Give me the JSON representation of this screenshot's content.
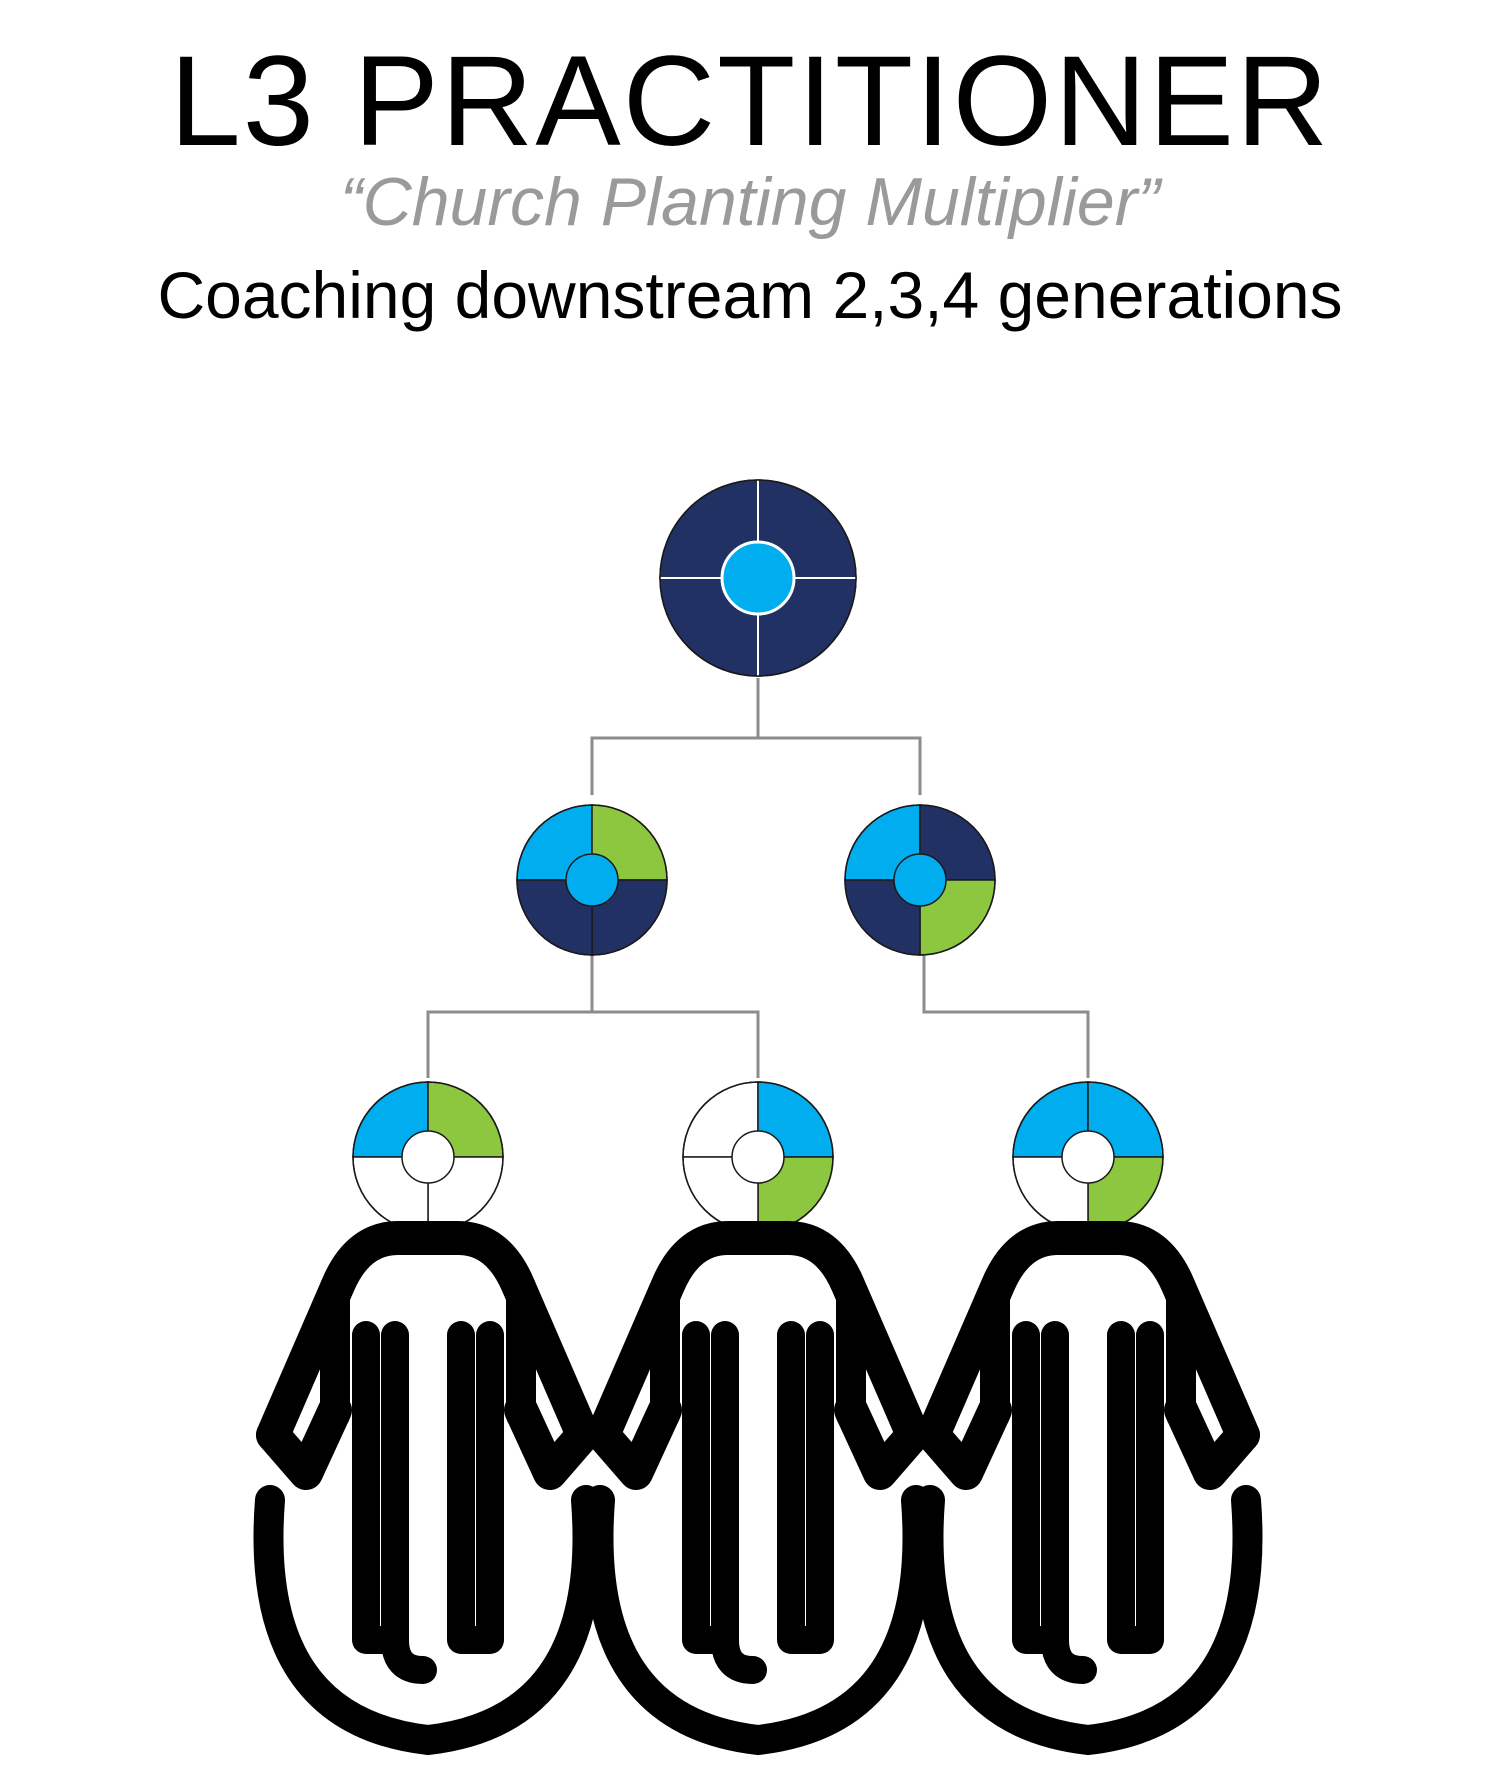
{
  "header": {
    "title": "L3 PRACTITIONER",
    "subtitle": "“Church Planting Multiplier”",
    "tagline": "Coaching downstream 2,3,4 generations"
  },
  "colors": {
    "navy": "#223163",
    "light_blue": "#00aeef",
    "green": "#8dc63f",
    "empty": "#ffffff",
    "connector": "#8c8c8c",
    "figure": "#000000"
  },
  "tree": {
    "generation_1": [
      {
        "quadrants": {
          "top_left": "navy",
          "top_right": "navy",
          "bottom_left": "navy",
          "bottom_right": "navy"
        },
        "center": "light_blue"
      }
    ],
    "generation_2": [
      {
        "quadrants": {
          "top_left": "light_blue",
          "top_right": "green",
          "bottom_left": "navy",
          "bottom_right": "navy"
        },
        "center": "light_blue"
      },
      {
        "quadrants": {
          "top_left": "light_blue",
          "top_right": "navy",
          "bottom_left": "navy",
          "bottom_right": "green"
        },
        "center": "light_blue"
      }
    ],
    "generation_3": [
      {
        "quadrants": {
          "top_left": "light_blue",
          "top_right": "green",
          "bottom_left": "empty",
          "bottom_right": "empty"
        },
        "center": "empty"
      },
      {
        "quadrants": {
          "top_left": "empty",
          "top_right": "light_blue",
          "bottom_left": "empty",
          "bottom_right": "green"
        },
        "center": "empty"
      },
      {
        "quadrants": {
          "top_left": "light_blue",
          "top_right": "light_blue",
          "bottom_left": "empty",
          "bottom_right": "green"
        },
        "center": "empty"
      }
    ]
  },
  "people": [
    {
      "icon": "person-icon"
    },
    {
      "icon": "person-icon"
    },
    {
      "icon": "person-icon"
    }
  ]
}
